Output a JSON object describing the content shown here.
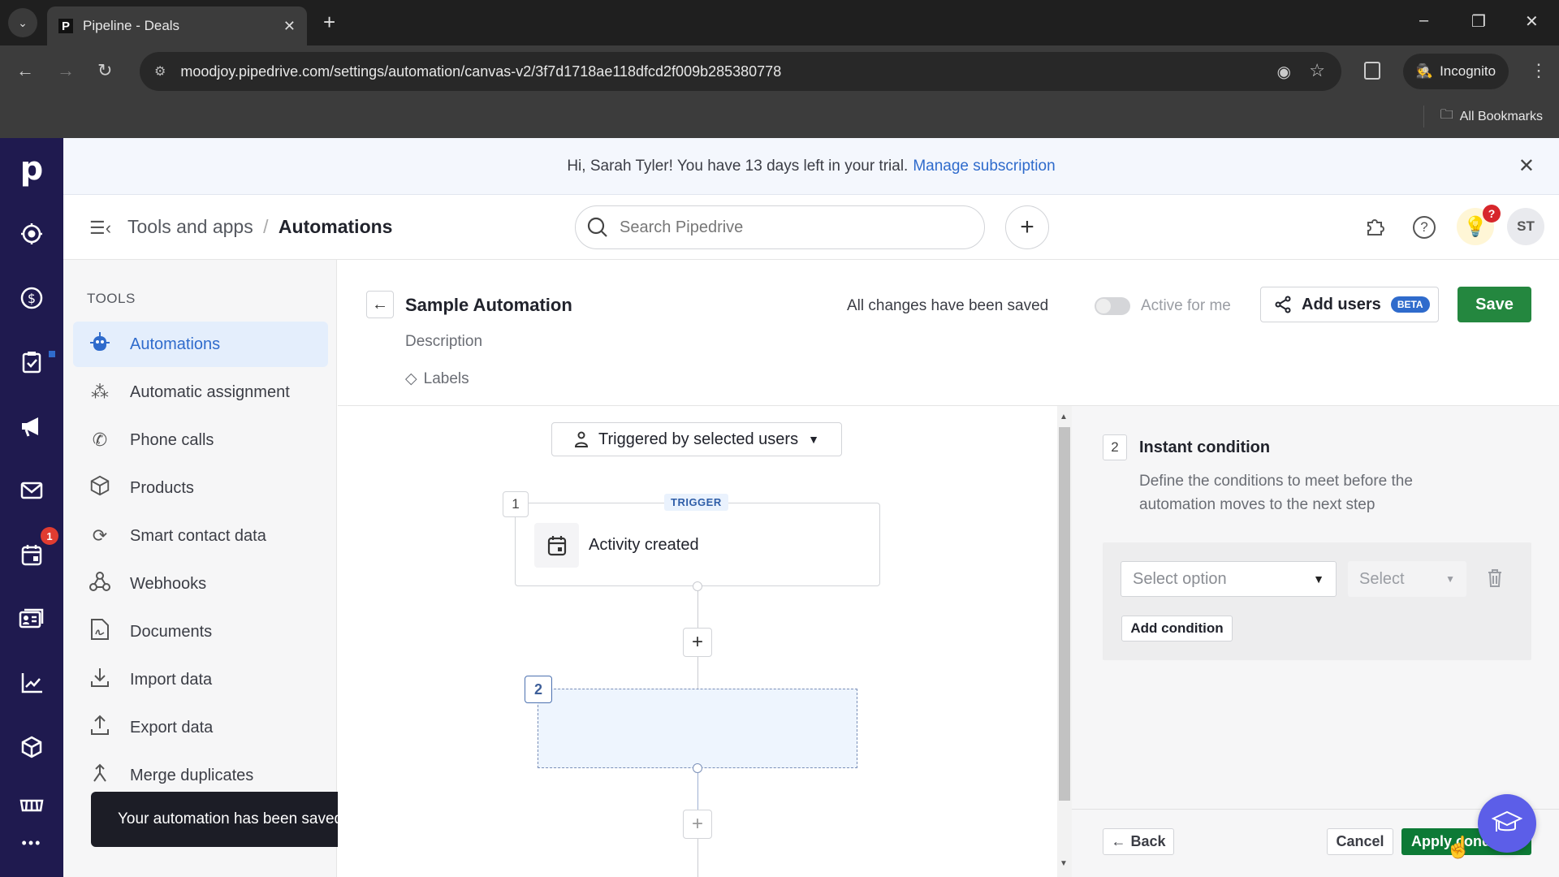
{
  "browser": {
    "tab_title": "Pipeline - Deals",
    "tab_favicon": "P",
    "url": "moodjoy.pipedrive.com/settings/automation/canvas-v2/3f7d1718ae118dfcd2f009b285380778",
    "incognito_label": "Incognito",
    "bookmarks_label": "All Bookmarks"
  },
  "banner": {
    "text": "Hi, Sarah Tyler! You have 13 days left in your trial.",
    "link": "Manage subscription"
  },
  "header": {
    "breadcrumb_parent": "Tools and apps",
    "breadcrumb_sep": "/",
    "breadcrumb_current": "Automations",
    "search_placeholder": "Search Pipedrive",
    "avatar_initials": "ST",
    "notification_badge": "?"
  },
  "leftnav": {
    "logo": "p",
    "items": [
      {
        "icon": "target-icon",
        "label": "Leads"
      },
      {
        "icon": "dollar-icon",
        "label": "Deals"
      },
      {
        "icon": "clipboard-check-icon",
        "label": "Projects"
      },
      {
        "icon": "megaphone-icon",
        "label": "Campaigns"
      },
      {
        "icon": "mail-icon",
        "label": "Mail"
      },
      {
        "icon": "calendar-icon",
        "label": "Activities",
        "badge": "1"
      },
      {
        "icon": "contacts-icon",
        "label": "Contacts"
      },
      {
        "icon": "chart-icon",
        "label": "Insights"
      },
      {
        "icon": "box-icon",
        "label": "Products"
      },
      {
        "icon": "marketplace-icon",
        "label": "Marketplace"
      },
      {
        "icon": "more-icon",
        "label": "More"
      }
    ]
  },
  "tools": {
    "title": "TOOLS",
    "items": [
      {
        "label": "Automations",
        "icon": "robot-icon",
        "active": true
      },
      {
        "label": "Automatic assignment",
        "icon": "assignment-icon"
      },
      {
        "label": "Phone calls",
        "icon": "phone-icon"
      },
      {
        "label": "Products",
        "icon": "box-icon"
      },
      {
        "label": "Smart contact data",
        "icon": "sync-icon"
      },
      {
        "label": "Webhooks",
        "icon": "webhook-icon"
      },
      {
        "label": "Documents",
        "icon": "document-icon"
      },
      {
        "label": "Import data",
        "icon": "import-icon"
      },
      {
        "label": "Export data",
        "icon": "export-icon"
      },
      {
        "label": "Merge duplicates",
        "icon": "merge-icon"
      }
    ]
  },
  "toast": "Your automation has been saved",
  "automation": {
    "title": "Sample Automation",
    "description_placeholder": "Description",
    "labels_label": "Labels",
    "saved_status": "All changes have been saved",
    "active_label": "Active for me",
    "active": false,
    "add_users_label": "Add users",
    "beta_label": "BETA",
    "save_label": "Save"
  },
  "canvas": {
    "trigger_dropdown": "Triggered by selected users",
    "node1": {
      "number": "1",
      "tag": "TRIGGER",
      "label": "Activity created"
    },
    "node2": {
      "number": "2"
    }
  },
  "panel": {
    "step_number": "2",
    "title": "Instant condition",
    "description": "Define the conditions to meet before the automation moves to the next step",
    "select_option_placeholder": "Select option",
    "select_placeholder": "Select",
    "add_condition_label": "Add condition",
    "back_label": "Back",
    "cancel_label": "Cancel",
    "apply_label": "Apply condition"
  },
  "colors": {
    "nav_bg": "#1f1a4f",
    "accent_blue": "#2f6bcc",
    "save_green": "#24873f",
    "apply_green": "#0d7a36",
    "academy_purple": "#5c5ee8",
    "badge_red": "#e03c31"
  }
}
